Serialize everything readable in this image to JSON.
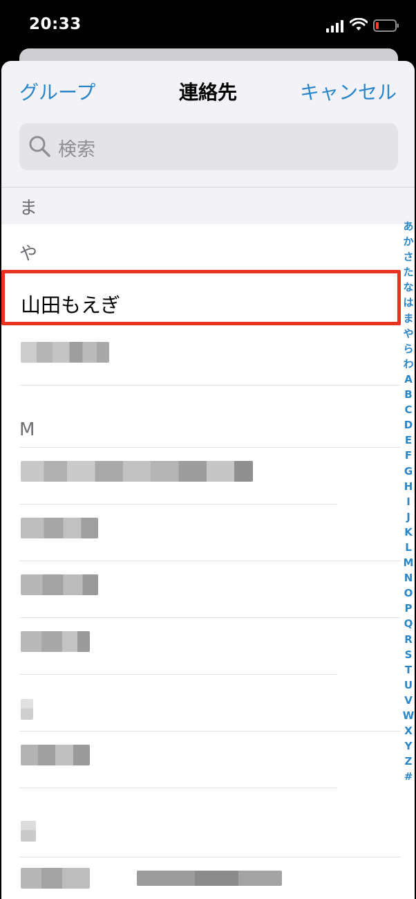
{
  "status_bar": {
    "time": "20:33"
  },
  "nav": {
    "left": "グループ",
    "title": "連絡先",
    "right": "キャンセル"
  },
  "search": {
    "placeholder": "検索"
  },
  "sections": {
    "ma": "ま",
    "ya": "や",
    "m": "M"
  },
  "contacts": {
    "highlighted": "山田もえぎ"
  },
  "index": [
    "あ",
    "か",
    "さ",
    "た",
    "な",
    "は",
    "ま",
    "や",
    "ら",
    "わ",
    "A",
    "B",
    "C",
    "D",
    "E",
    "F",
    "G",
    "H",
    "I",
    "J",
    "K",
    "L",
    "M",
    "N",
    "O",
    "P",
    "Q",
    "R",
    "S",
    "T",
    "U",
    "V",
    "W",
    "X",
    "Y",
    "Z",
    "#"
  ],
  "colors": {
    "accent": "#2b86c8",
    "highlight": "#e8331f"
  }
}
